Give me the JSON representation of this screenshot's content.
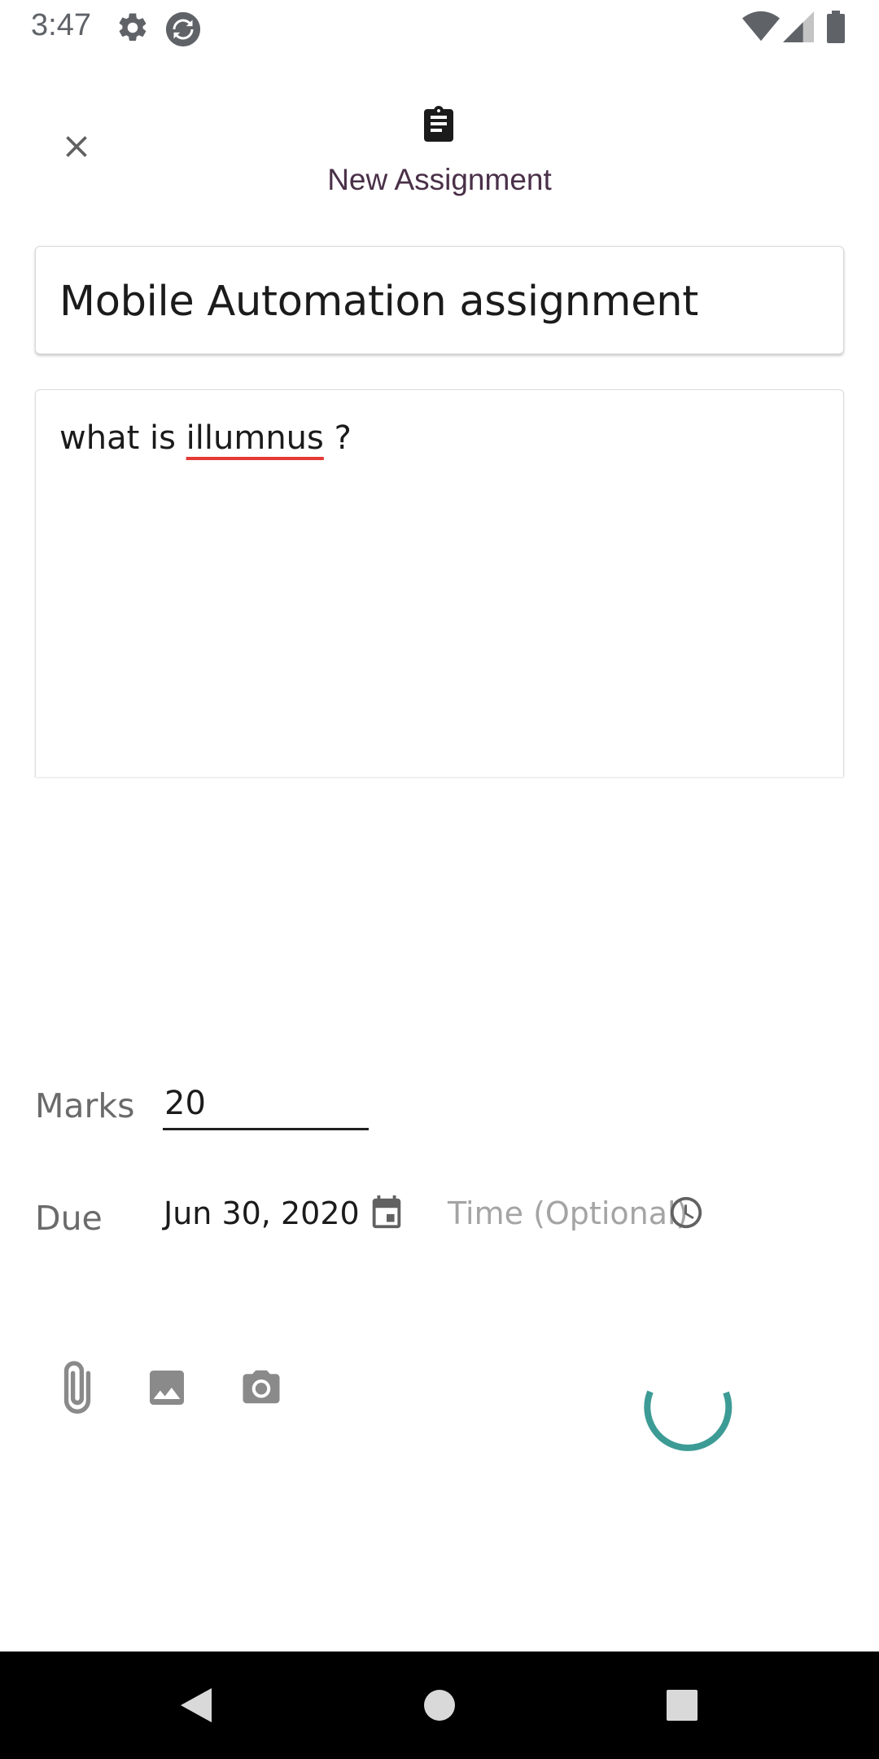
{
  "status_bar": {
    "time": "3:47",
    "icons": [
      "settings-icon",
      "sync-icon",
      "wifi-icon",
      "cellular-signal-icon",
      "battery-icon"
    ]
  },
  "header": {
    "close_icon": "close-icon",
    "title_icon": "assignment-icon",
    "title": "New Assignment"
  },
  "form": {
    "title_value": "Mobile Automation assignment",
    "description": {
      "before": "what is ",
      "misspelled": "illumnus",
      "after": " ?"
    },
    "marks": {
      "label": "Marks",
      "value": "20"
    },
    "due": {
      "label": "Due",
      "date": "Jun 30, 2020",
      "time_placeholder": "Time (Optional)"
    }
  },
  "attachments": [
    "attach-file-icon",
    "image-icon",
    "camera-icon"
  ],
  "loading": true,
  "nav_bar": [
    "back-button",
    "home-button",
    "recents-button"
  ],
  "colors": {
    "title_text": "#4a3048",
    "spinner": "#3d9b96",
    "spell_underline": "#e53935",
    "icon_gray": "#757575"
  }
}
